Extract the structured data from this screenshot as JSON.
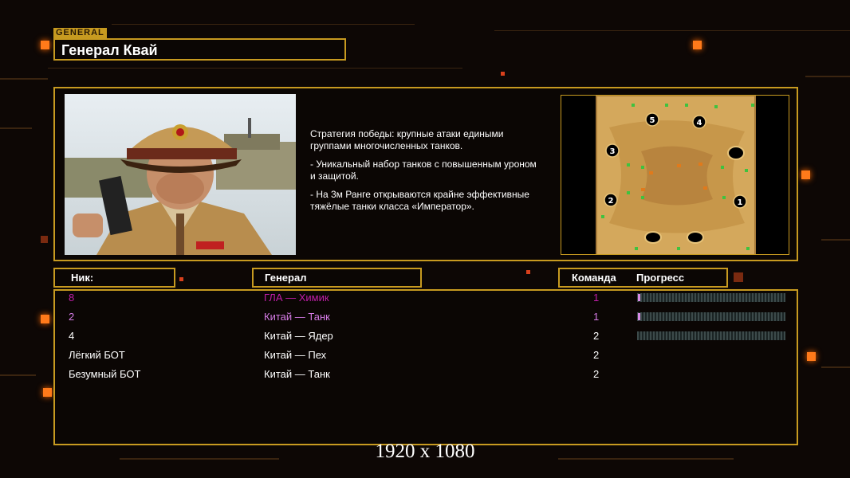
{
  "header": {
    "tag": "GENERAL",
    "title": "Генерал Квай"
  },
  "description": [
    "Стратегия победы: крупные атаки едиными\n группами многочисленных танков.",
    "- Уникальный набор танков с повышенным уроном\n  и защитой.",
    "- На 3м Ранге открываются крайне эффективные\n  тяжёлые танки класса «Император»."
  ],
  "map": {
    "start_positions": [
      "5",
      "4",
      "3",
      "2",
      "1"
    ]
  },
  "table": {
    "col_nick": "Ник:",
    "col_general": "Генерал",
    "col_team": "Команда",
    "col_progress": "Прогресс",
    "rows": [
      {
        "nick": "8",
        "general": "ГЛА — Химик",
        "team": "1",
        "color": "#c01ea8",
        "progress": 0.01
      },
      {
        "nick": "2",
        "general": "Китай — Танк",
        "team": "1",
        "color": "#d67ce6",
        "progress": 0.01
      },
      {
        "nick": "4",
        "general": "Китай — Ядер",
        "team": "2",
        "color": "#ffffff",
        "progress": 0
      },
      {
        "nick": "Лёгкий БОТ",
        "general": "Китай — Пех",
        "team": "2",
        "color": "#ffffff",
        "progress": null
      },
      {
        "nick": "Безумный БОТ",
        "general": "Китай — Танк",
        "team": "2",
        "color": "#ffffff",
        "progress": null
      }
    ]
  },
  "watermark": "1920 x 1080",
  "colors": {
    "accent": "#c79a20",
    "glow": "#ff7a1a"
  }
}
